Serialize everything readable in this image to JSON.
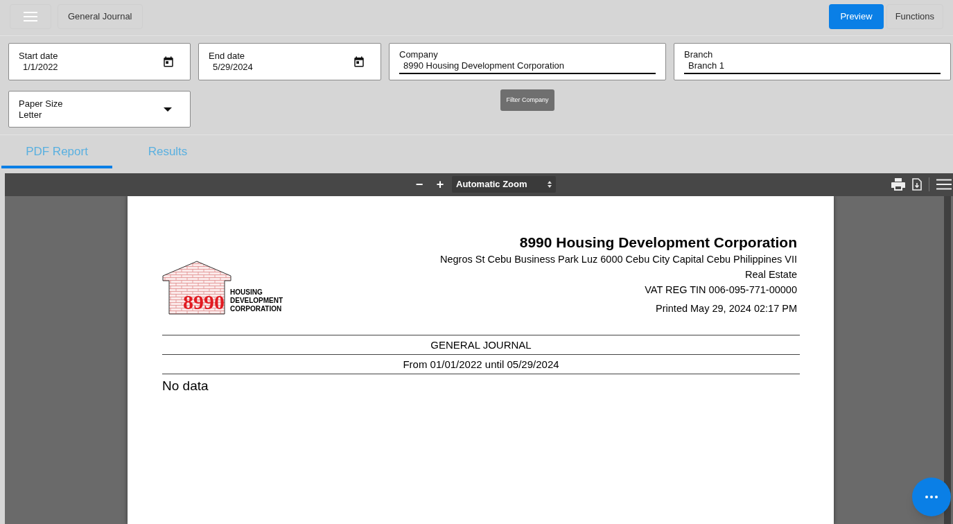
{
  "top_bar": {
    "title": "General Journal",
    "buttons": [
      {
        "label": "Preview",
        "primary": true
      },
      {
        "label": "Functions",
        "primary": false
      }
    ]
  },
  "filters": [
    {
      "kind": "date",
      "label": "Start date",
      "value": "1/1/2022"
    },
    {
      "kind": "date",
      "label": "End date",
      "value": "5/29/2024"
    },
    {
      "kind": "text",
      "label": "Company",
      "value": "8990 Housing Development Corporation"
    },
    {
      "kind": "text",
      "label": "Branch",
      "value": "Branch 1"
    },
    {
      "kind": "select",
      "label": "Paper Size",
      "value": "Letter"
    }
  ],
  "filter_company_button": "Filter Company",
  "tabs": [
    {
      "label": "PDF Report",
      "selected": true
    },
    {
      "label": "Results",
      "selected": false
    }
  ],
  "pdf_viewer": {
    "zoom_out": "−",
    "zoom_in": "+",
    "zoom_select": "Automatic Zoom",
    "page": {
      "logo": {
        "number": "8990",
        "lines": [
          "HOUSING",
          "DEVELOPMENT",
          "CORPORATION"
        ]
      },
      "company_name": "8990 Housing Development Corporation",
      "address_lines": [
        "Negros St Cebu Business Park Luz 6000 Cebu City Capital Cebu Philippines VII",
        "Real Estate",
        "VAT REG TIN 006-095-771-00000"
      ],
      "printed": "Printed May 29, 2024 02:17 PM",
      "report_title": "GENERAL JOURNAL",
      "date_range": "From 01/01/2022 until 05/29/2024",
      "empty_message": "No data"
    }
  }
}
